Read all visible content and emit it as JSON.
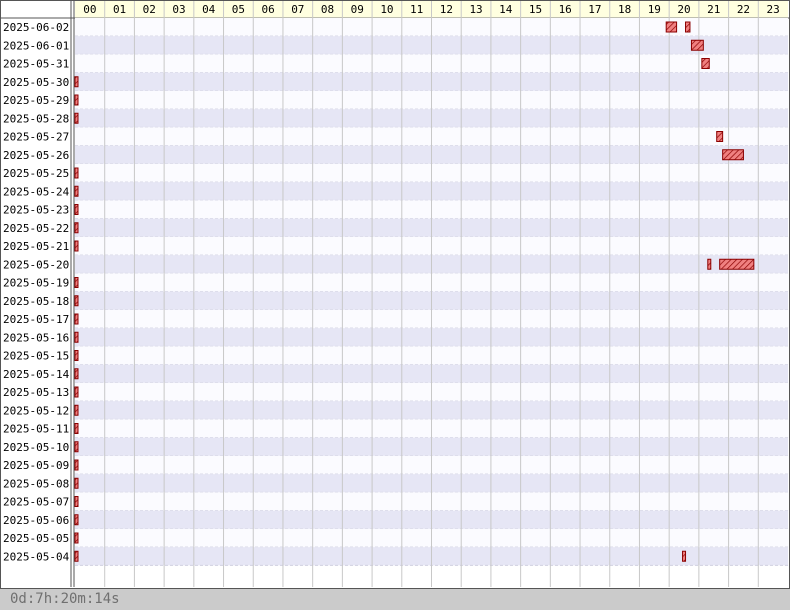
{
  "chart_data": {
    "type": "gantt",
    "x_unit": "hour of day",
    "hours": [
      "00",
      "01",
      "02",
      "03",
      "04",
      "05",
      "06",
      "07",
      "08",
      "09",
      "10",
      "11",
      "12",
      "13",
      "14",
      "15",
      "16",
      "17",
      "18",
      "19",
      "20",
      "21",
      "22",
      "23"
    ],
    "dates": [
      "2025-06-02",
      "2025-06-01",
      "2025-05-31",
      "2025-05-30",
      "2025-05-29",
      "2025-05-28",
      "2025-05-27",
      "2025-05-26",
      "2025-05-25",
      "2025-05-24",
      "2025-05-23",
      "2025-05-22",
      "2025-05-21",
      "2025-05-20",
      "2025-05-19",
      "2025-05-18",
      "2025-05-17",
      "2025-05-16",
      "2025-05-15",
      "2025-05-14",
      "2025-05-13",
      "2025-05-12",
      "2025-05-11",
      "2025-05-10",
      "2025-05-09",
      "2025-05-08",
      "2025-05-07",
      "2025-05-06",
      "2025-05-05",
      "2025-05-04"
    ],
    "intervals": [
      {
        "date": "2025-06-02",
        "start": 19.9,
        "end": 20.25
      },
      {
        "date": "2025-06-02",
        "start": 20.55,
        "end": 20.7
      },
      {
        "date": "2025-06-01",
        "start": 20.75,
        "end": 21.15
      },
      {
        "date": "2025-05-31",
        "start": 21.1,
        "end": 21.35
      },
      {
        "date": "2025-05-30",
        "start": 0.0,
        "end": 0.1
      },
      {
        "date": "2025-05-29",
        "start": 0.0,
        "end": 0.1
      },
      {
        "date": "2025-05-28",
        "start": 0.0,
        "end": 0.1
      },
      {
        "date": "2025-05-27",
        "start": 21.6,
        "end": 21.8
      },
      {
        "date": "2025-05-26",
        "start": 21.8,
        "end": 22.5
      },
      {
        "date": "2025-05-25",
        "start": 0.0,
        "end": 0.1
      },
      {
        "date": "2025-05-24",
        "start": 0.0,
        "end": 0.1
      },
      {
        "date": "2025-05-23",
        "start": 0.0,
        "end": 0.1
      },
      {
        "date": "2025-05-22",
        "start": 0.0,
        "end": 0.1
      },
      {
        "date": "2025-05-21",
        "start": 0.0,
        "end": 0.1
      },
      {
        "date": "2025-05-20",
        "start": 21.3,
        "end": 21.4
      },
      {
        "date": "2025-05-20",
        "start": 21.7,
        "end": 22.85
      },
      {
        "date": "2025-05-19",
        "start": 0.0,
        "end": 0.1
      },
      {
        "date": "2025-05-18",
        "start": 0.0,
        "end": 0.1
      },
      {
        "date": "2025-05-17",
        "start": 0.0,
        "end": 0.1
      },
      {
        "date": "2025-05-16",
        "start": 0.0,
        "end": 0.1
      },
      {
        "date": "2025-05-15",
        "start": 0.0,
        "end": 0.1
      },
      {
        "date": "2025-05-14",
        "start": 0.0,
        "end": 0.1
      },
      {
        "date": "2025-05-13",
        "start": 0.0,
        "end": 0.1
      },
      {
        "date": "2025-05-12",
        "start": 0.0,
        "end": 0.1
      },
      {
        "date": "2025-05-11",
        "start": 0.0,
        "end": 0.1
      },
      {
        "date": "2025-05-10",
        "start": 0.0,
        "end": 0.1
      },
      {
        "date": "2025-05-09",
        "start": 0.0,
        "end": 0.1
      },
      {
        "date": "2025-05-08",
        "start": 0.0,
        "end": 0.1
      },
      {
        "date": "2025-05-07",
        "start": 0.0,
        "end": 0.1
      },
      {
        "date": "2025-05-06",
        "start": 0.0,
        "end": 0.1
      },
      {
        "date": "2025-05-05",
        "start": 0.0,
        "end": 0.1
      },
      {
        "date": "2025-05-04",
        "start": 0.0,
        "end": 0.1
      },
      {
        "date": "2025-05-04",
        "start": 20.45,
        "end": 20.55
      }
    ],
    "xlim": [
      0,
      24
    ],
    "grid": true,
    "total": "0d:7h:20m:14s"
  },
  "colors": {
    "header_bg": "#ffffe0",
    "row_alt": "#e6e6f5",
    "row_base": "#fbfbff",
    "bar_fill": "#f08080",
    "bar_stroke": "#8b0000",
    "grid_major": "#c8c8c8",
    "footer_bg": "#cbcbcb"
  }
}
